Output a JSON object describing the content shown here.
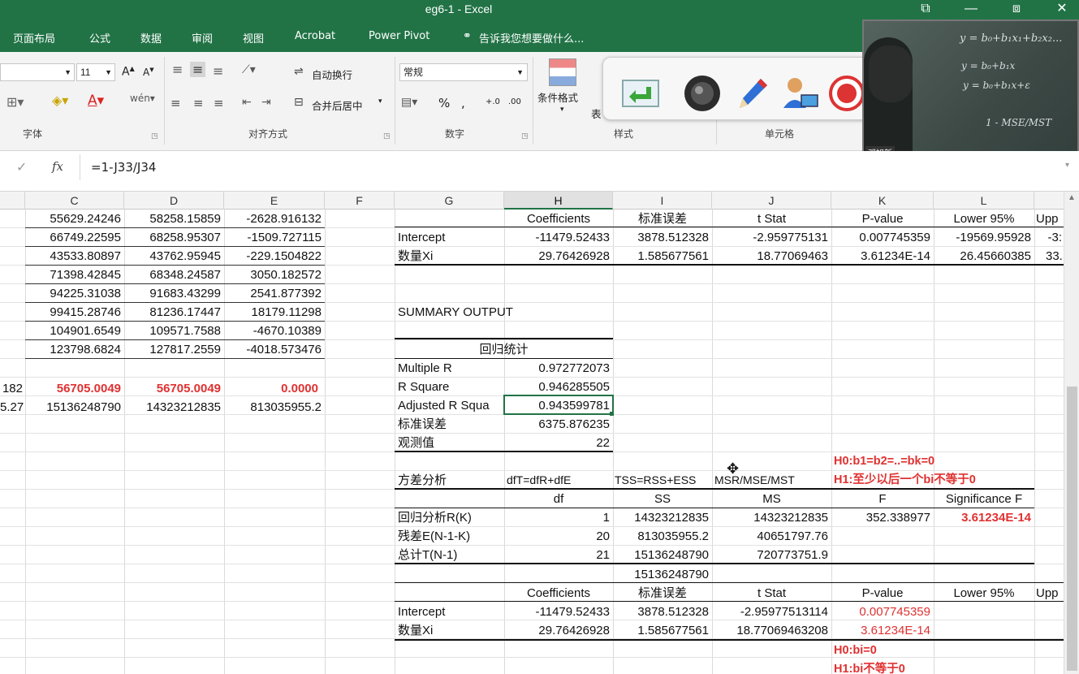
{
  "window": {
    "title": "eg6-1 - Excel",
    "controls": [
      "⧉",
      "—",
      "⧈",
      "✕"
    ]
  },
  "ribbon_tabs": [
    "页面布局",
    "公式",
    "数据",
    "审阅",
    "视图",
    "Acrobat",
    "Power Pivot",
    "告诉我您想要做什么..."
  ],
  "ribbon": {
    "font_size": "11",
    "wrap_text": "自动换行",
    "merge_center": "合并后居中",
    "number_format": "常规",
    "conditional_format": "条件格式",
    "table_hint": "表",
    "groups": {
      "font": "字体",
      "alignment": "对齐方式",
      "number": "数字",
      "styles": "样式",
      "cells": "单元格"
    }
  },
  "webcam": {
    "caption": "邓旭新",
    "formulas": [
      "y = b₀+b₁x₁+b₂x₂...",
      "y = b₀+b₁x",
      "y = b₀+b₁x+ε",
      "1 - MSE/MST"
    ]
  },
  "formula_bar": {
    "fx": "fx",
    "formula": "=1-J33/J34"
  },
  "columns": [
    "C",
    "D",
    "E",
    "F",
    "G",
    "H",
    "I",
    "J",
    "K",
    "L"
  ],
  "left_table": [
    [
      "55629.24246",
      "58258.15859",
      "-2628.916132"
    ],
    [
      "66749.22595",
      "68258.95307",
      "-1509.727115"
    ],
    [
      "43533.80897",
      "43762.95945",
      "-229.1504822"
    ],
    [
      "71398.42845",
      "68348.24587",
      "3050.182572"
    ],
    [
      "94225.31038",
      "91683.43299",
      "2541.877392"
    ],
    [
      "99415.28746",
      "81236.17447",
      "18179.11298"
    ],
    [
      "104901.6549",
      "109571.7588",
      "-4670.10389"
    ],
    [
      "123798.6824",
      "127817.2559",
      "-4018.573476"
    ]
  ],
  "left_partial": {
    "row10": "182",
    "row11": "5.27"
  },
  "left_sums": {
    "row10": [
      "56705.0049",
      "56705.0049",
      "0.0000"
    ],
    "row11": [
      "15136248790",
      "14323212835",
      "813035955.2"
    ]
  },
  "coef_header": [
    "Coefficients",
    "标准误差",
    "t Stat",
    "P-value",
    "Lower 95%",
    "Upp"
  ],
  "coef_rows": [
    {
      "label": "Intercept",
      "values": [
        "-11479.52433",
        "3878.512328",
        "-2.959775131",
        "0.007745359",
        "-19569.95928",
        "-3:"
      ]
    },
    {
      "label": "数量Xi",
      "values": [
        "29.76426928",
        "1.585677561",
        "18.77069463",
        "3.61234E-14",
        "26.45660385",
        "33."
      ]
    }
  ],
  "summary_output": "SUMMARY OUTPUT",
  "regression_stats_title": "回归统计",
  "regression_stats": [
    {
      "label": "Multiple R",
      "value": "0.972772073"
    },
    {
      "label": "R Square",
      "value": "0.946285505"
    },
    {
      "label": "Adjusted R Squa",
      "value": "0.943599781"
    },
    {
      "label": "标准误差",
      "value": "6375.876235"
    },
    {
      "label": "观测值",
      "value": "22"
    }
  ],
  "notes": {
    "h0_all": "H0:b1=b2=..=bk=0",
    "h1_all": "H1:至少以后一个bi不等于0",
    "h0_bi": "H0:bi=0",
    "h1_bi": "H1:bi不等于0"
  },
  "anova": {
    "title": "方差分析",
    "formulas": [
      "dfT=dfR+dfE",
      "TSS=RSS+ESS",
      "MSR/MSE/MST"
    ],
    "header": [
      "df",
      "SS",
      "MS",
      "F",
      "Significance F"
    ],
    "rows": [
      {
        "label": "回归分析R(K)",
        "df": "1",
        "ss": "14323212835",
        "ms": "14323212835",
        "f": "352.338977",
        "sig": "3.61234E-14"
      },
      {
        "label": "残差E(N-1-K)",
        "df": "20",
        "ss": "813035955.2",
        "ms": "40651797.76",
        "f": "",
        "sig": ""
      },
      {
        "label": "总计T(N-1)",
        "df": "21",
        "ss": "15136248790",
        "ms": "720773751.9",
        "f": "",
        "sig": ""
      }
    ],
    "ss_check": "15136248790"
  },
  "coef2_header": [
    "Coefficients",
    "标准误差",
    "t Stat",
    "P-value",
    "Lower 95%",
    "Upp"
  ],
  "coef2_rows": [
    {
      "label": "Intercept",
      "values": [
        "-11479.52433",
        "3878.512328",
        "-2.95977513114",
        "0.007745359"
      ]
    },
    {
      "label": "数量Xi",
      "values": [
        "29.76426928",
        "1.585677561",
        "18.77069463208",
        "3.61234E-14"
      ]
    }
  ]
}
